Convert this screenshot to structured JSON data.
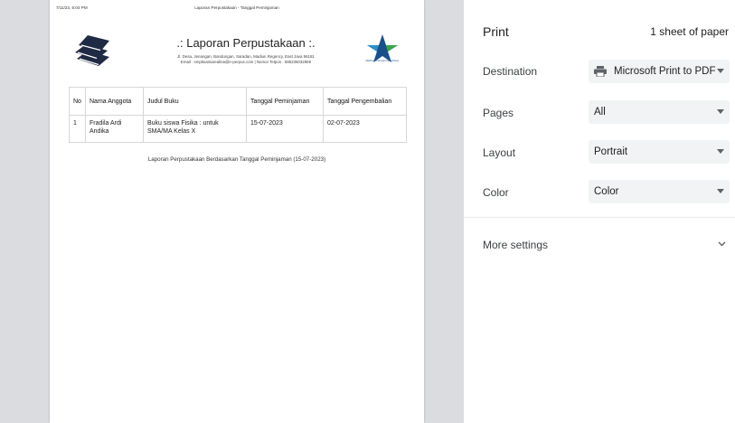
{
  "preview": {
    "header_date": "7/11/23, 6:04 PM",
    "header_title": "Laporan Perpustakaan - Tanggal Peminjaman",
    "report_title": ".: Laporan Perpustakaan :.",
    "address_line": "Jl. Desa, Jenangan, Bandungan, Saradan, Madiun Regency, East Java 96181",
    "contact_line": "Email : smpksantarealina@e-perpus.com | Nomor Telpon : 085235032969",
    "logo_text": "PERPUSTAKAAN NASIONAL",
    "table": {
      "headers": [
        "No",
        "Nama Anggota",
        "Judul Buku",
        "Tanggal Peminjaman",
        "Tanggal Pengembalian"
      ],
      "rows": [
        [
          "1",
          "Fradila Ardi Andika",
          "Buku siswa Fisika : untuk SMA/MA Kelas X",
          "15-07-2023",
          "02-07-2023"
        ]
      ]
    },
    "caption": "Laporan Perpustakaan Berdasarkan Tanggal Peminjaman (15-07-2023)"
  },
  "settings": {
    "title": "Print",
    "sheets": "1 sheet of paper",
    "destination_label": "Destination",
    "destination_value": "Microsoft Print to PDF",
    "pages_label": "Pages",
    "pages_value": "All",
    "layout_label": "Layout",
    "layout_value": "Portrait",
    "color_label": "Color",
    "color_value": "Color",
    "more_settings": "More settings"
  },
  "icons": {
    "books": "books-icon",
    "library_logo": "library-logo",
    "printer": "printer-icon",
    "chevron": "chevron-down-icon"
  },
  "colors": {
    "preview_bg": "#dadce0",
    "book_color": "#1f2a44",
    "select_bg": "#f1f3f4"
  }
}
